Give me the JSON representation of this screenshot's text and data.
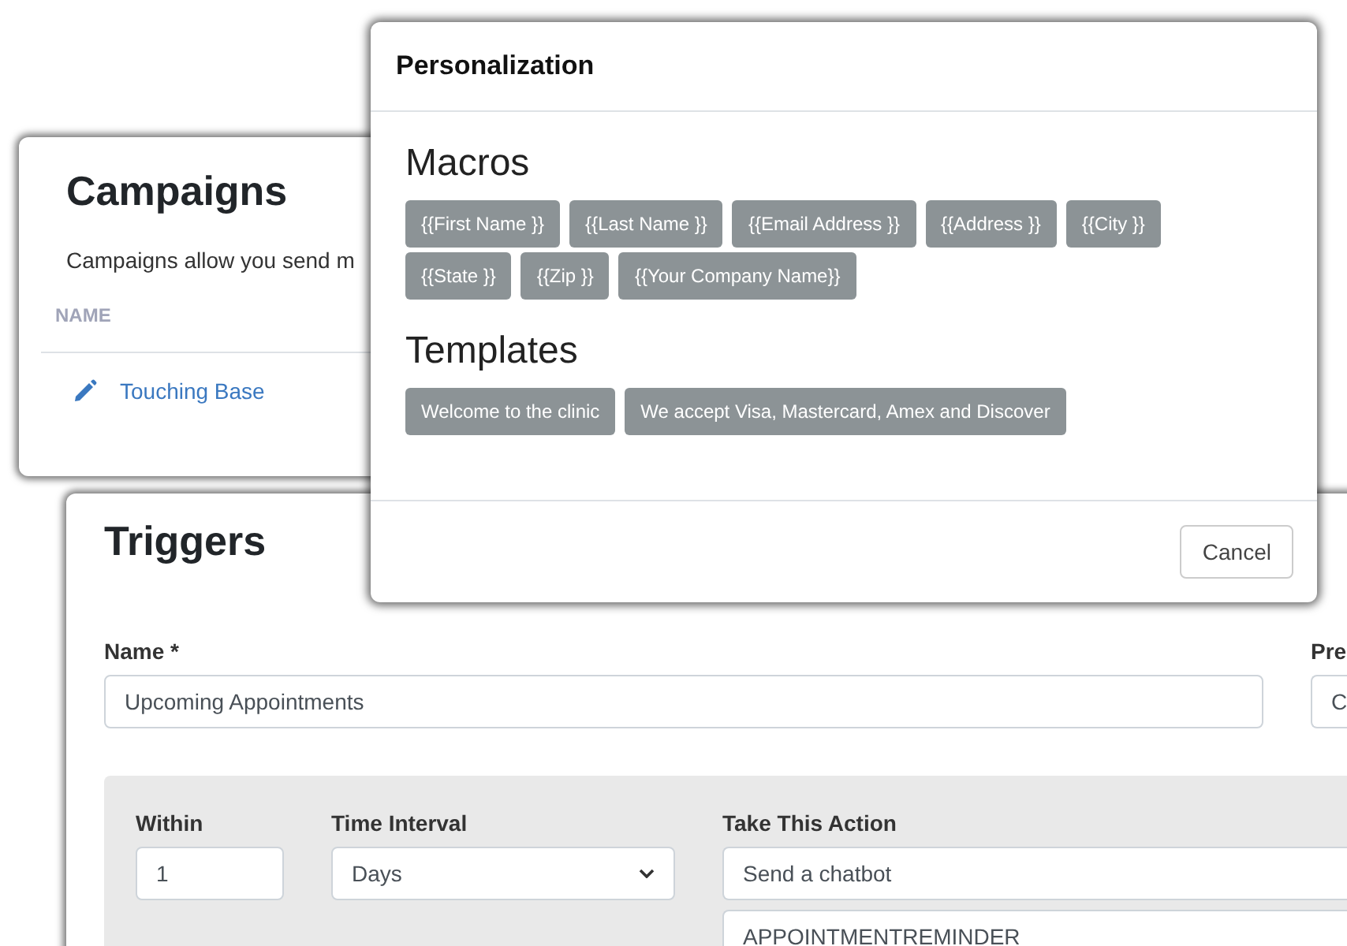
{
  "campaigns": {
    "title": "Campaigns",
    "description": "Campaigns allow you send m",
    "columns": [
      "NAME"
    ],
    "rows": [
      {
        "name": "Touching Base"
      }
    ]
  },
  "triggers": {
    "title": "Triggers",
    "fields": [
      {
        "label": "Name *",
        "value": "Upcoming Appointments"
      },
      {
        "label": "Pre",
        "value": "C"
      }
    ],
    "rule": {
      "within": {
        "label": "Within",
        "value": "1"
      },
      "interval": {
        "label": "Time Interval",
        "value": "Days"
      },
      "action": {
        "label": "Take This Action",
        "value": "Send a chatbot",
        "detail": "APPOINTMENTREMINDER"
      }
    }
  },
  "modal": {
    "title": "Personalization",
    "sections": [
      {
        "heading": "Macros",
        "chips": [
          "{{First Name }}",
          "{{Last Name }}",
          "{{Email Address }}",
          "{{Address }}",
          "{{City }}",
          "{{State }}",
          "{{Zip }}",
          "{{Your Company Name}}"
        ]
      },
      {
        "heading": "Templates",
        "chips": [
          "Welcome to the clinic",
          "We accept Visa, Mastercard, Amex and Discover"
        ]
      }
    ],
    "buttons": [
      "Cancel"
    ]
  }
}
